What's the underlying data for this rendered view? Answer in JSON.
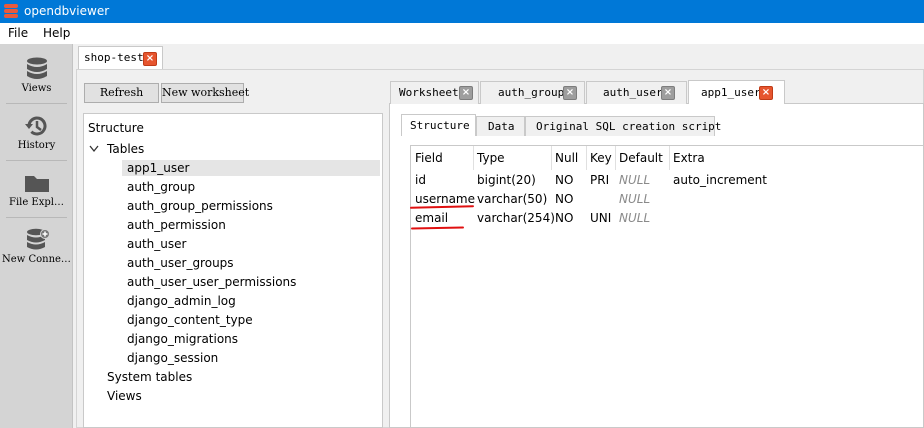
{
  "window": {
    "title": "opendbviewer"
  },
  "menu": [
    "File",
    "Help"
  ],
  "sidebar": [
    {
      "label": "Views",
      "icon": "database-icon"
    },
    {
      "label": "History",
      "icon": "history-icon"
    },
    {
      "label": "File Expl…",
      "icon": "folder-icon"
    },
    {
      "label": "New Conne…",
      "icon": "new-connection-icon"
    }
  ],
  "connection_tab": {
    "label": "shop-test"
  },
  "toolbar": {
    "refresh": "Refresh",
    "new_worksheet": "New worksheet"
  },
  "tree": {
    "root": "Structure",
    "tables_label": "Tables",
    "tables": [
      "app1_user",
      "auth_group",
      "auth_group_permissions",
      "auth_permission",
      "auth_user",
      "auth_user_groups",
      "auth_user_user_permissions",
      "django_admin_log",
      "django_content_type",
      "django_migrations",
      "django_session"
    ],
    "selected": "app1_user",
    "system_tables": "System tables",
    "views": "Views"
  },
  "worksheet_tabs": [
    {
      "label": "Worksheet"
    },
    {
      "label": "auth_group"
    },
    {
      "label": "auth_user"
    },
    {
      "label": "app1_user",
      "active": true
    }
  ],
  "sub_tabs": [
    "Structure",
    "Data",
    "Original SQL creation script"
  ],
  "columns_table": {
    "headers": [
      "Field",
      "Type",
      "Null",
      "Key",
      "Default",
      "Extra"
    ],
    "rows": [
      [
        "id",
        "bigint(20)",
        "NO",
        "PRI",
        "NULL",
        "auto_increment"
      ],
      [
        "username",
        "varchar(50)",
        "NO",
        "",
        "NULL",
        ""
      ],
      [
        "email",
        "varchar(254)",
        "NO",
        "UNI",
        "NULL",
        ""
      ]
    ]
  },
  "colors": {
    "titlebar": "#0078d7",
    "close_active": "#e6552e",
    "close_inactive": "#9e9e9e",
    "annotation": "#e01010"
  }
}
